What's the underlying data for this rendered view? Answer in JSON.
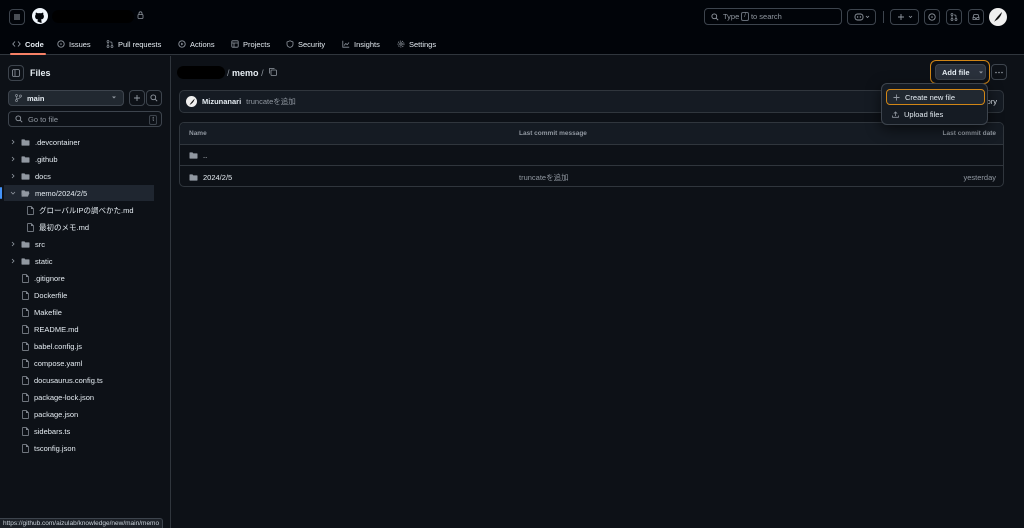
{
  "header": {
    "search_prefix": "Type",
    "search_key": "/",
    "search_suffix": "to search"
  },
  "tabs": [
    {
      "label": "Code",
      "icon": "code-icon"
    },
    {
      "label": "Issues",
      "icon": "issue-icon"
    },
    {
      "label": "Pull requests",
      "icon": "pull-request-icon"
    },
    {
      "label": "Actions",
      "icon": "play-icon"
    },
    {
      "label": "Projects",
      "icon": "table-icon"
    },
    {
      "label": "Security",
      "icon": "shield-icon"
    },
    {
      "label": "Insights",
      "icon": "graph-icon"
    },
    {
      "label": "Settings",
      "icon": "gear-icon"
    }
  ],
  "sidebar": {
    "title": "Files",
    "branch": "main",
    "go_to_file_placeholder": "Go to file",
    "go_to_file_key": "t",
    "tree": [
      {
        "name": ".devcontainer",
        "type": "folder",
        "expanded": false
      },
      {
        "name": ".github",
        "type": "folder",
        "expanded": false
      },
      {
        "name": "docs",
        "type": "folder",
        "expanded": false
      },
      {
        "name": "memo/2024/2/5",
        "type": "folder",
        "expanded": true,
        "selected": true
      },
      {
        "name": "グローバルIPの調べかた.md",
        "type": "file",
        "child": true
      },
      {
        "name": "最初のメモ.md",
        "type": "file",
        "child": true
      },
      {
        "name": "src",
        "type": "folder",
        "expanded": false
      },
      {
        "name": "static",
        "type": "folder",
        "expanded": false
      },
      {
        "name": ".gitignore",
        "type": "file"
      },
      {
        "name": "Dockerfile",
        "type": "file"
      },
      {
        "name": "Makefile",
        "type": "file"
      },
      {
        "name": "README.md",
        "type": "file"
      },
      {
        "name": "babel.config.js",
        "type": "file"
      },
      {
        "name": "compose.yaml",
        "type": "file"
      },
      {
        "name": "docusaurus.config.ts",
        "type": "file"
      },
      {
        "name": "package-lock.json",
        "type": "file"
      },
      {
        "name": "package.json",
        "type": "file"
      },
      {
        "name": "sidebars.ts",
        "type": "file"
      },
      {
        "name": "tsconfig.json",
        "type": "file"
      }
    ]
  },
  "breadcrumb": {
    "current": "memo",
    "separator": "/"
  },
  "actions": {
    "add_file": "Add file"
  },
  "commit": {
    "author": "Mizunanari",
    "message": "truncateを追加",
    "history_label": "tory"
  },
  "table": {
    "headers": {
      "name": "Name",
      "message": "Last commit message",
      "date": "Last commit date"
    },
    "rows": [
      {
        "name": "..",
        "message": "",
        "date": ""
      },
      {
        "name": "2024/2/5",
        "message": "truncateを追加",
        "date": "yesterday"
      }
    ]
  },
  "dropdown": {
    "items": [
      {
        "label": "Create new file",
        "icon": "plus-icon",
        "highlighted": true
      },
      {
        "label": "Upload files",
        "icon": "upload-icon",
        "highlighted": false
      }
    ]
  },
  "status_url": "https://github.com/aizulab/knowledge/new/main/memo",
  "colors": {
    "background": "#0d1117",
    "header": "#010409",
    "border": "#30363d",
    "accent_tab": "#f78166",
    "highlight_ring": "#d18616",
    "selected_bar": "#4493f8"
  }
}
